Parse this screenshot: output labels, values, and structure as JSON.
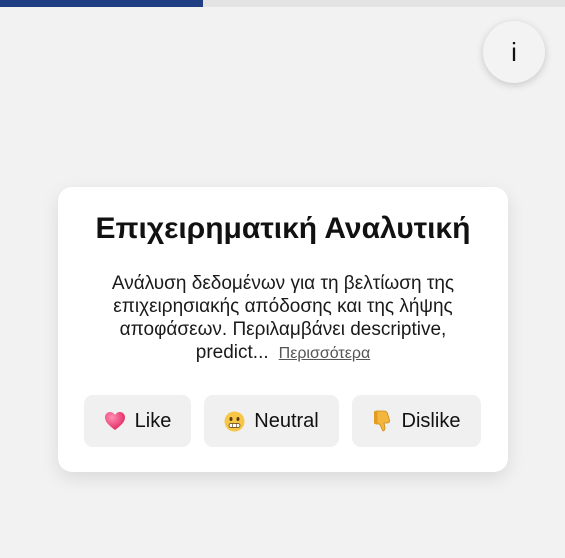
{
  "progress": {
    "fraction": 0.36,
    "fill_color": "#1f3f82",
    "track_color": "#e3e3e3"
  },
  "info_button": {
    "label": "i"
  },
  "card": {
    "title": "Επιχειρηματική Αναλυτική",
    "description": "Ανάλυση δεδομένων για τη βελτίωση της επιχειρησιακής απόδοσης και της λήψης αποφάσεων. Περιλαμβάνει descriptive, predict...",
    "more_label": "Περισσότερα"
  },
  "buttons": {
    "like": {
      "label": "Like",
      "icon": "heart-icon"
    },
    "neutral": {
      "label": "Neutral",
      "icon": "grimacing-face-icon"
    },
    "dislike": {
      "label": "Dislike",
      "icon": "thumbs-down-icon"
    }
  }
}
